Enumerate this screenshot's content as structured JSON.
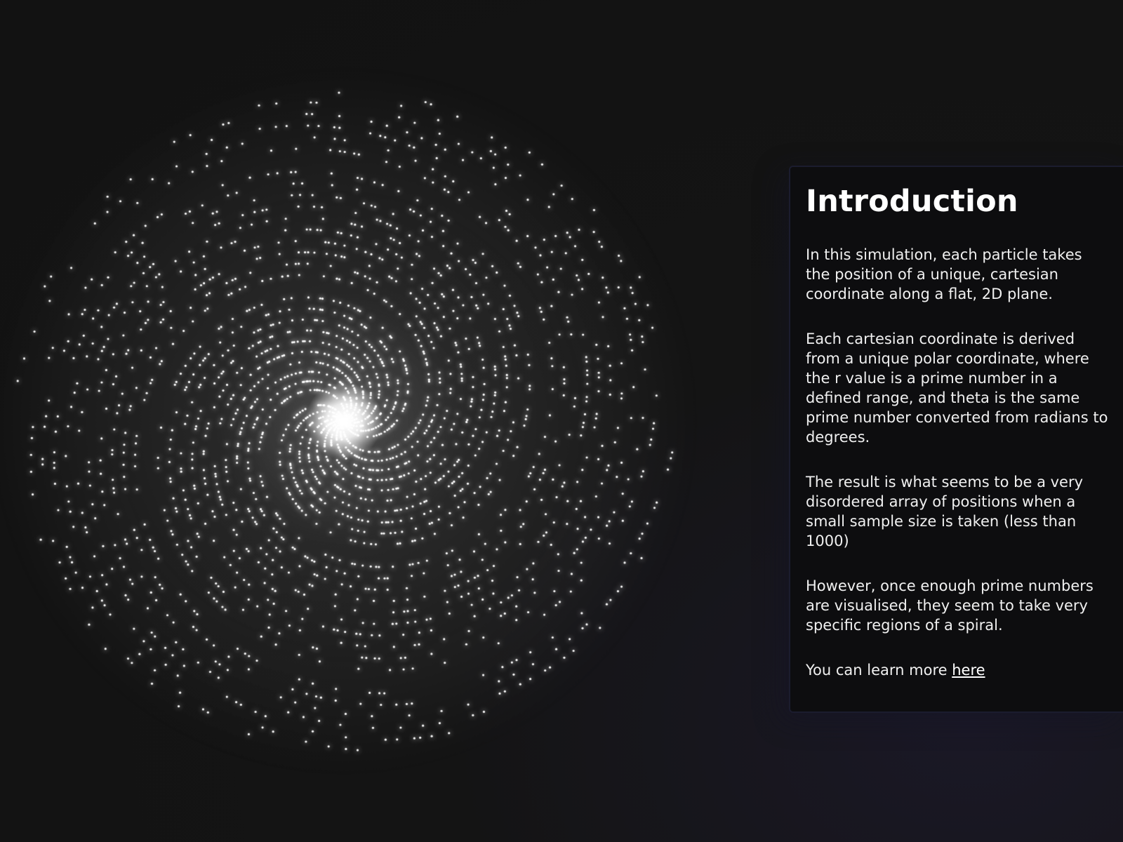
{
  "panel": {
    "title": "Introduction",
    "paragraphs": [
      "In this simulation, each particle takes the position of a unique, cartesian coordinate along a flat, 2D plane.",
      "Each cartesian coordinate is derived from a unique polar coordinate, where the r value is a prime number in a defined range, and theta is the same prime number converted from radians to degrees.",
      "The result is what seems to be a very disordered array of positions when a small sample size is taken (less than 1000)",
      "However, once enough prime numbers are visualised, they seem to take very specific regions of a spiral."
    ],
    "learn_more_prefix": "You can learn more ",
    "learn_more_link": "here"
  },
  "colors": {
    "background": "#131313",
    "panel_background": "#0d0d0f",
    "panel_border": "#1b1c2e",
    "particle": "#ffffff",
    "text": "#f0f0f0"
  }
}
